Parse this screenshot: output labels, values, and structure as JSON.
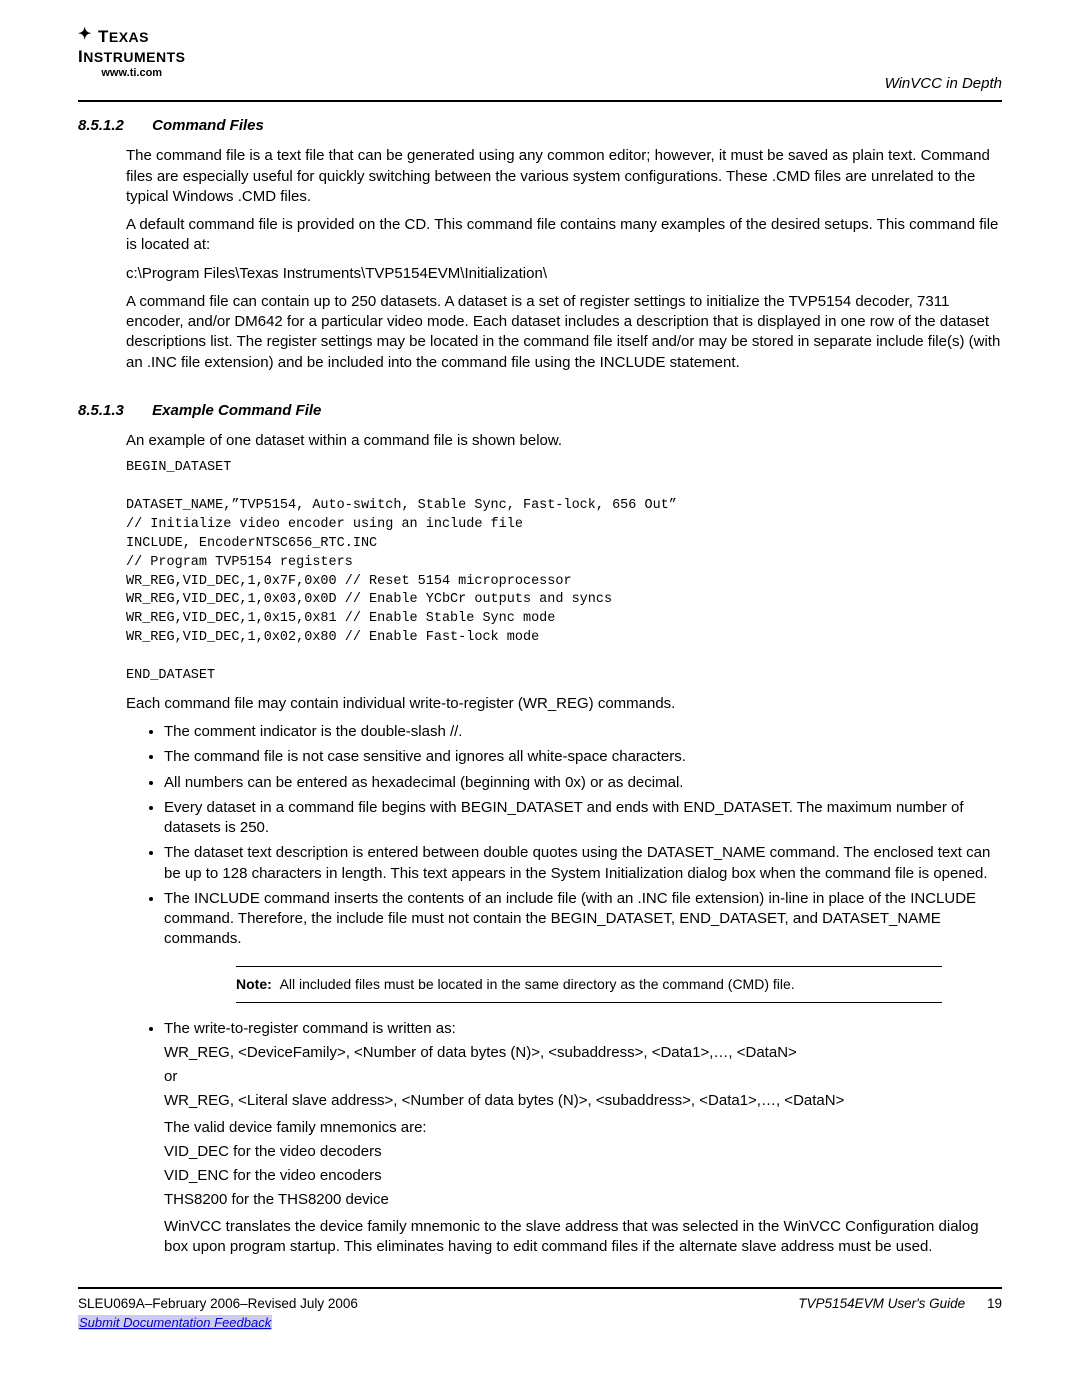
{
  "logo": {
    "brand": "Texas Instruments",
    "url": "www.ti.com"
  },
  "header_right": "WinVCC in Depth",
  "sec1": {
    "num": "8.5.1.2",
    "title": "Command Files",
    "p1": "The command file is a text file that can be generated using any common editor; however, it must be saved as plain text. Command files are especially useful for quickly switching between the various system configurations. These .CMD files are unrelated to the typical Windows .CMD files.",
    "p2": "A default command file is provided on the CD. This command file contains many examples of the desired setups. This command file is located at:",
    "path": "c:\\Program Files\\Texas Instruments\\TVP5154EVM\\Initialization\\",
    "p3": "A command file can contain up to 250 datasets. A dataset is a set of register settings to initialize the TVP5154 decoder, 7311 encoder, and/or DM642 for a particular video mode. Each dataset includes a description that is displayed in one row of the dataset descriptions list. The register settings may be located in the command file itself and/or may be stored in separate include file(s) (with an .INC file extension) and be included into the command file using the INCLUDE statement."
  },
  "sec2": {
    "num": "8.5.1.3",
    "title": "Example Command File",
    "intro": "An example of one dataset within a command file is shown below.",
    "code": "BEGIN_DATASET\n\nDATASET_NAME,”TVP5154, Auto-switch, Stable Sync, Fast-lock, 656 Out”\n// Initialize video encoder using an include file\nINCLUDE, EncoderNTSC656_RTC.INC\n// Program TVP5154 registers\nWR_REG,VID_DEC,1,0x7F,0x00 // Reset 5154 microprocessor\nWR_REG,VID_DEC,1,0x03,0x0D // Enable YCbCr outputs and syncs\nWR_REG,VID_DEC,1,0x15,0x81 // Enable Stable Sync mode\nWR_REG,VID_DEC,1,0x02,0x80 // Enable Fast-lock mode\n\nEND_DATASET",
    "after_code": "Each command file may contain individual write-to-register (WR_REG) commands.",
    "bullets": [
      "The comment indicator is the double-slash //.",
      "The command file is not case sensitive and ignores all white-space characters.",
      "All numbers can be entered as hexadecimal (beginning with 0x) or as decimal.",
      "Every dataset in a command file begins with BEGIN_DATASET and ends with END_DATASET. The maximum number of datasets is 250.",
      "The dataset text description is entered between double quotes using the DATASET_NAME command. The enclosed text can be up to 128 characters in length. This text appears in the System Initialization dialog box when the command file is opened.",
      "The INCLUDE command inserts the contents of an include file (with an .INC file extension) in-line in place of the INCLUDE command. Therefore, the include file must not contain the BEGIN_DATASET, END_DATASET, and DATASET_NAME commands."
    ],
    "note_label": "Note:",
    "note": "All included files must be located in the same directory as the command (CMD) file.",
    "bullet7_lead": "The write-to-register command is written as:",
    "bullet7_l1": "WR_REG, <DeviceFamily>, <Number of data bytes (N)>, <subaddress>, <Data1>,…, <DataN>",
    "bullet7_or": "or",
    "bullet7_l2": "WR_REG, <Literal slave address>, <Number of data bytes (N)>, <subaddress>, <Data1>,…, <DataN>",
    "bullet7_l3": "The valid device family mnemonics are:",
    "bullet7_l4": "VID_DEC for the video decoders",
    "bullet7_l5": "VID_ENC for the video encoders",
    "bullet7_l6": "THS8200 for the THS8200 device",
    "bullet7_p2": "WinVCC translates the device family mnemonic to the slave address that was selected in the WinVCC Configuration dialog box upon program startup. This eliminates having to edit command files if the alternate slave address must be used."
  },
  "footer": {
    "left": "SLEU069A–February 2006–Revised July 2006",
    "right": "TVP5154EVM User's Guide",
    "page": "19",
    "link": "Submit Documentation Feedback"
  }
}
